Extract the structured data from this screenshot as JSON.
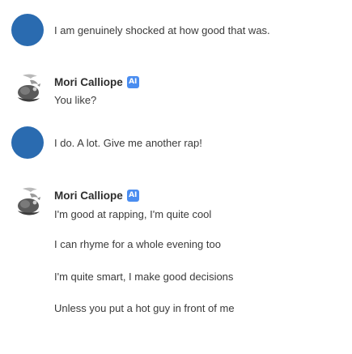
{
  "messages": [
    {
      "role": "user",
      "text": "I am genuinely shocked at how good that was."
    },
    {
      "role": "bot",
      "name": "Mori Calliope",
      "badge": "AI",
      "lines": [
        "You like?"
      ]
    },
    {
      "role": "user",
      "text": "I do. A lot. Give me another rap!"
    },
    {
      "role": "bot",
      "name": "Mori Calliope",
      "badge": "AI",
      "lines": [
        "I'm good at rapping, I'm quite cool",
        "I can rhyme for a whole evening too",
        "I'm quite smart, I make good decisions",
        "Unless you put a hot guy in front of me"
      ]
    }
  ],
  "colors": {
    "user_avatar": "#2a6bb0",
    "ai_badge": "#4a8df0"
  }
}
